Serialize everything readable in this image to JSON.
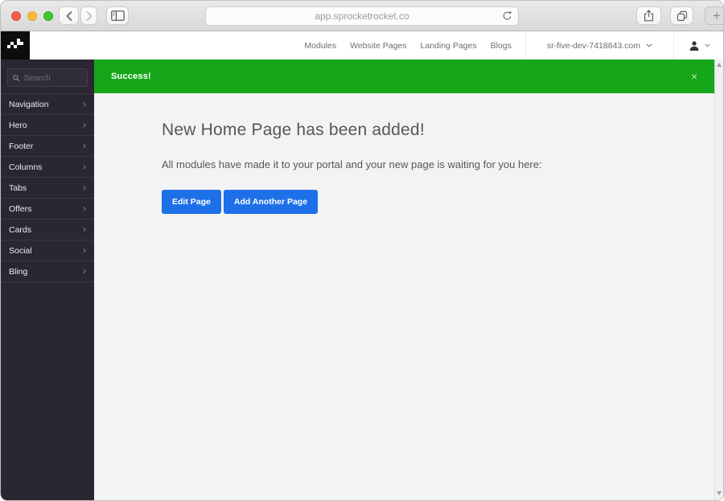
{
  "browser": {
    "url": "app.sprocketrocket.co",
    "new_tab_label": "+"
  },
  "topbar": {
    "nav_links": [
      {
        "label": "Modules"
      },
      {
        "label": "Website Pages"
      },
      {
        "label": "Landing Pages"
      },
      {
        "label": "Blogs"
      }
    ],
    "domain": "sr-five-dev-7418843.com"
  },
  "sidebar": {
    "search_placeholder": "Search",
    "items": [
      {
        "label": "Navigation"
      },
      {
        "label": "Hero"
      },
      {
        "label": "Footer"
      },
      {
        "label": "Columns"
      },
      {
        "label": "Tabs"
      },
      {
        "label": "Offers"
      },
      {
        "label": "Cards"
      },
      {
        "label": "Social"
      },
      {
        "label": "Bling"
      }
    ],
    "chevron_right": "›"
  },
  "banner": {
    "message": "Success!",
    "close": "×"
  },
  "content": {
    "heading": "New Home Page has been added!",
    "body": "All modules have made it to your portal and your new page is waiting for you here:",
    "buttons": [
      {
        "label": "Edit Page"
      },
      {
        "label": "Add Another Page"
      }
    ]
  },
  "colors": {
    "success_green": "#15a619",
    "accent_blue": "#1e70e8",
    "sidebar_bg": "#2a2733"
  }
}
